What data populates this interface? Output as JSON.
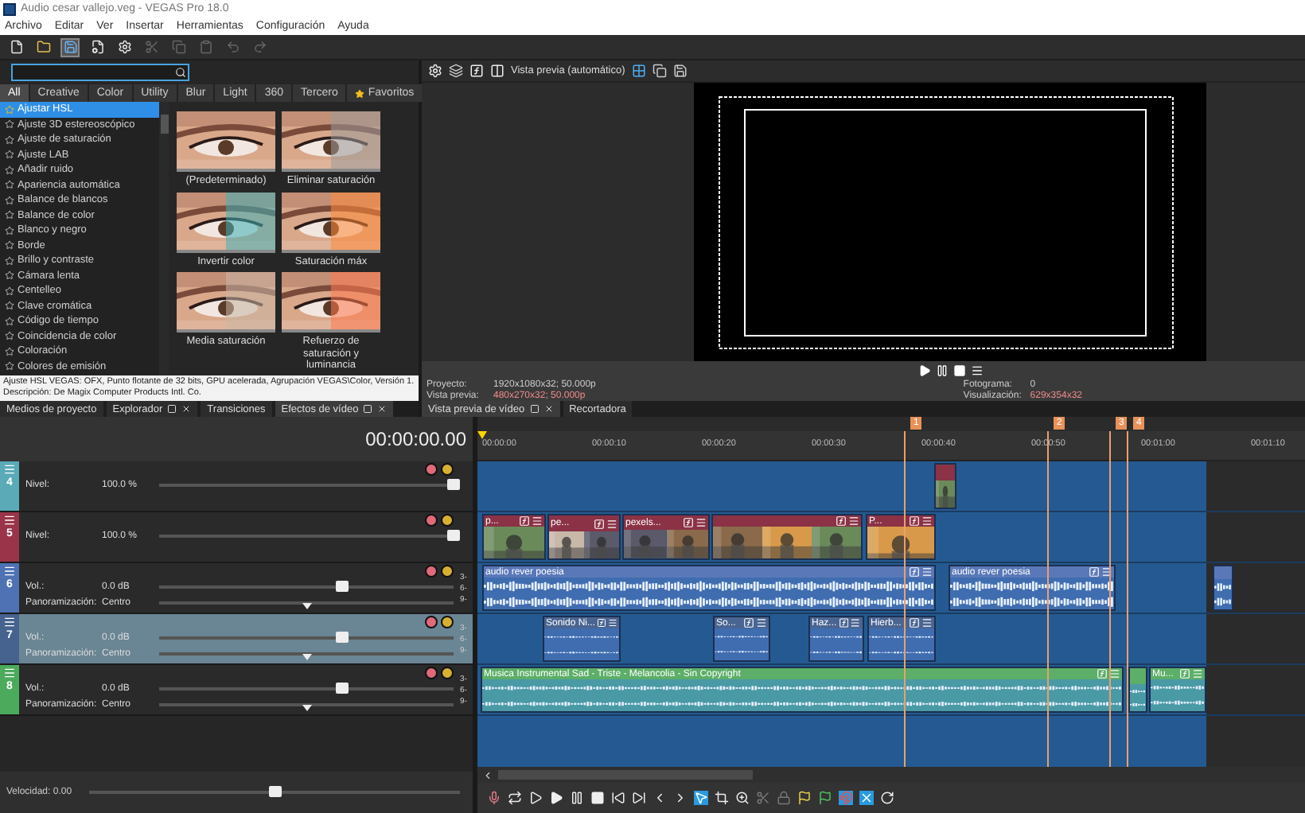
{
  "window": {
    "title": "Audio cesar vallejo.veg - VEGAS Pro 18.0"
  },
  "menu": [
    "Archivo",
    "Editar",
    "Ver",
    "Insertar",
    "Herramientas",
    "Configuración",
    "Ayuda"
  ],
  "effects": {
    "categories": [
      {
        "label": "All",
        "selected": true
      },
      {
        "label": "Creative",
        "selected": false
      },
      {
        "label": "Color",
        "selected": false
      },
      {
        "label": "Utility",
        "selected": false
      },
      {
        "label": "Blur",
        "selected": false
      },
      {
        "label": "Light",
        "selected": false
      },
      {
        "label": "360",
        "selected": false
      },
      {
        "label": "Tercero",
        "selected": false
      },
      {
        "label": "Favoritos",
        "selected": false,
        "kind": "favorites"
      }
    ],
    "items": [
      {
        "label": "Ajustar HSL",
        "selected": true
      },
      {
        "label": "Ajuste 3D estereoscópico",
        "selected": false
      },
      {
        "label": "Ajuste de saturación",
        "selected": false
      },
      {
        "label": "Ajuste LAB",
        "selected": false
      },
      {
        "label": "Añadir ruido",
        "selected": false
      },
      {
        "label": "Apariencia automática",
        "selected": false
      },
      {
        "label": "Balance de blancos",
        "selected": false
      },
      {
        "label": "Balance de color",
        "selected": false
      },
      {
        "label": "Blanco y negro",
        "selected": false
      },
      {
        "label": "Borde",
        "selected": false
      },
      {
        "label": "Brillo y contraste",
        "selected": false
      },
      {
        "label": "Cámara lenta",
        "selected": false
      },
      {
        "label": "Centelleo",
        "selected": false
      },
      {
        "label": "Clave cromática",
        "selected": false
      },
      {
        "label": "Código de tiempo",
        "selected": false
      },
      {
        "label": "Coincidencia de color",
        "selected": false
      },
      {
        "label": "Coloración",
        "selected": false
      },
      {
        "label": "Colores de emisión",
        "selected": false
      }
    ],
    "presets": [
      {
        "label": "(Predeterminado)"
      },
      {
        "label": "Eliminar saturación"
      },
      {
        "label": "Invertir color"
      },
      {
        "label": "Saturación máx"
      },
      {
        "label": "Media saturación"
      },
      {
        "label": "Refuerzo de saturación y luminancia"
      }
    ],
    "description": [
      "Ajuste HSL VEGAS: OFX, Punto flotante de 32 bits, GPU acelerada, Agrupación VEGAS\\Color, Versión 1.",
      "Descripción: De Magix Computer Products Intl. Co."
    ],
    "tabs": [
      {
        "label": "Medios de proyecto",
        "selected": false,
        "closable": false
      },
      {
        "label": "Explorador",
        "selected": false,
        "closable": true
      },
      {
        "label": "Transiciones",
        "selected": false,
        "closable": false
      },
      {
        "label": "Efectos de vídeo",
        "selected": true,
        "closable": true
      }
    ]
  },
  "preview": {
    "mode": "Vista previa (automático)",
    "info_left": [
      {
        "label": "Proyecto:",
        "value": "1920x1080x32; 50.000p"
      },
      {
        "label": "Vista previa:",
        "value": "480x270x32; 50.000p"
      }
    ],
    "info_right": [
      {
        "label": "Fotograma:",
        "value": "0"
      },
      {
        "label": "Visualización:",
        "value": "629x354x32"
      }
    ],
    "tabs": [
      {
        "label": "Vista previa de vídeo",
        "selected": true,
        "closable": true
      },
      {
        "label": "Recortadora",
        "selected": false,
        "closable": false
      }
    ]
  },
  "timeline": {
    "timecode": "00:00:00.00",
    "ruler": [
      "00:00:00",
      "00:00:10",
      "00:00:20",
      "00:00:30",
      "00:00:40",
      "00:00:50",
      "00:01:00",
      "00:01:10"
    ],
    "markers": [
      "1",
      "2",
      "3",
      "4"
    ],
    "tracks": [
      {
        "kind": "video",
        "number": "4",
        "color": "#5aaab8",
        "selected": false,
        "params": [
          {
            "label": "Nivel:",
            "value": "100.0 %",
            "level": 1
          }
        ],
        "clips": [
          {
            "fx": false
          }
        ]
      },
      {
        "kind": "video",
        "number": "5",
        "color": "#9a3449",
        "selected": false,
        "params": [
          {
            "label": "Nivel:",
            "value": "100.0 %",
            "level": 1
          }
        ],
        "clips": [
          {
            "label": "p...",
            "fx": true
          },
          {
            "label": "pe...",
            "fx": true
          },
          {
            "label": "pexels...",
            "fx": true
          },
          {
            "fx": true
          },
          {
            "label": "P...",
            "fx": true
          }
        ]
      },
      {
        "kind": "audio",
        "number": "6",
        "color": "#4e72b4",
        "selected": false,
        "meter": [
          "3-",
          "6-",
          "9-"
        ],
        "params": [
          {
            "label": "Vol.:",
            "value": "0.0 dB",
            "level": 0.62
          },
          {
            "label": "Panoramización:",
            "value": "Centro",
            "level": 0.5
          }
        ],
        "clips": [
          {
            "label": "audio rever poesia",
            "fx": true
          },
          {
            "label": "audio rever poesia",
            "fx": true
          },
          {
            "fx": false
          }
        ]
      },
      {
        "kind": "audio",
        "number": "7",
        "color": "#46638f",
        "selected": true,
        "meter": [
          "3-",
          "6-",
          "9-"
        ],
        "params": [
          {
            "label": "Vol.:",
            "value": "0.0 dB",
            "level": 0.62
          },
          {
            "label": "Panoramización:",
            "value": "Centro",
            "level": 0.5
          }
        ],
        "clips": [
          {
            "label": "Sonido Ni...",
            "fx": true
          },
          {
            "label": "So...",
            "fx": true
          },
          {
            "label": "Haz...",
            "fx": true
          },
          {
            "label": "Hierb...",
            "fx": true
          }
        ]
      },
      {
        "kind": "audio",
        "number": "8",
        "color": "#4caa5c",
        "selected": false,
        "meter": [
          "3-",
          "6-",
          "9-"
        ],
        "params": [
          {
            "label": "Vol.:",
            "value": "0.0 dB",
            "level": 0.62
          },
          {
            "label": "Panoramización:",
            "value": "Centro",
            "level": 0.5
          }
        ],
        "clips": [
          {
            "label": "Musica Instrumental Sad - Triste - Melancolia - Sin Copyright",
            "fx": true
          },
          {
            "fx": false
          },
          {
            "label": "Mu...",
            "fx": true
          }
        ]
      }
    ],
    "speed": {
      "label": "Velocidad: 0.00",
      "level": 0.5
    }
  }
}
